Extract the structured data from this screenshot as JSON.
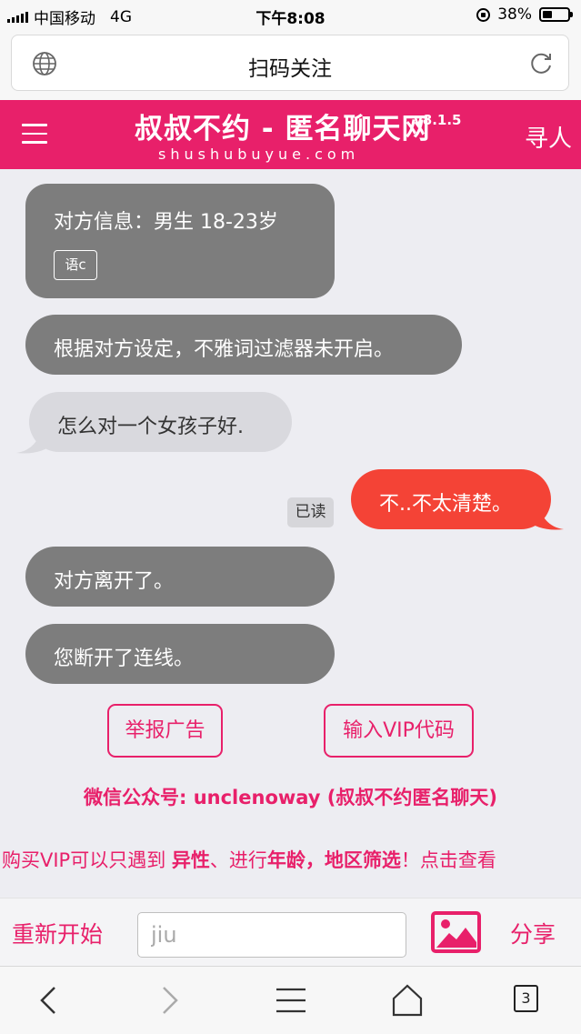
{
  "status_bar": {
    "carrier": "中国移动",
    "network": "4G",
    "time": "下午8:08",
    "battery_percent": "38%",
    "battery_level": 0.38
  },
  "browser": {
    "page_title": "扫码关注",
    "tab_count": "3"
  },
  "header": {
    "title": "叔叔不约 - 匿名聊天网",
    "version": "v8.1.5",
    "domain": "shushubuyue.com",
    "find_label": "寻人"
  },
  "chat": {
    "partner_info": "对方信息：男生 18-23岁",
    "lang_badge": "语c",
    "filter_notice": "根据对方设定，不雅词过滤器未开启。",
    "incoming_message": "怎么对一个女孩子好.",
    "outgoing_message": "不..不太清楚。",
    "read_status": "已读",
    "partner_left": "对方离开了。",
    "disconnected": "您断开了连线。"
  },
  "actions": {
    "report_ad": "举报广告",
    "enter_vip_code": "输入VIP代码"
  },
  "wechat_line": "微信公众号: unclenoway (叔叔不约匿名聊天)",
  "promo": {
    "p1": "购买VIP可以只遇到 ",
    "b1": "异性",
    "p2": "、进行",
    "b2": "年龄，地区筛选",
    "p3": "！点击查看"
  },
  "bottom_bar": {
    "restart": "重新开始",
    "input_value": "jiu",
    "share": "分享"
  },
  "colors": {
    "brand": "#e8206a",
    "outgoing_bubble": "#f44336",
    "system_bubble": "#7d7d7d",
    "incoming_bubble": "#d9d9de"
  }
}
